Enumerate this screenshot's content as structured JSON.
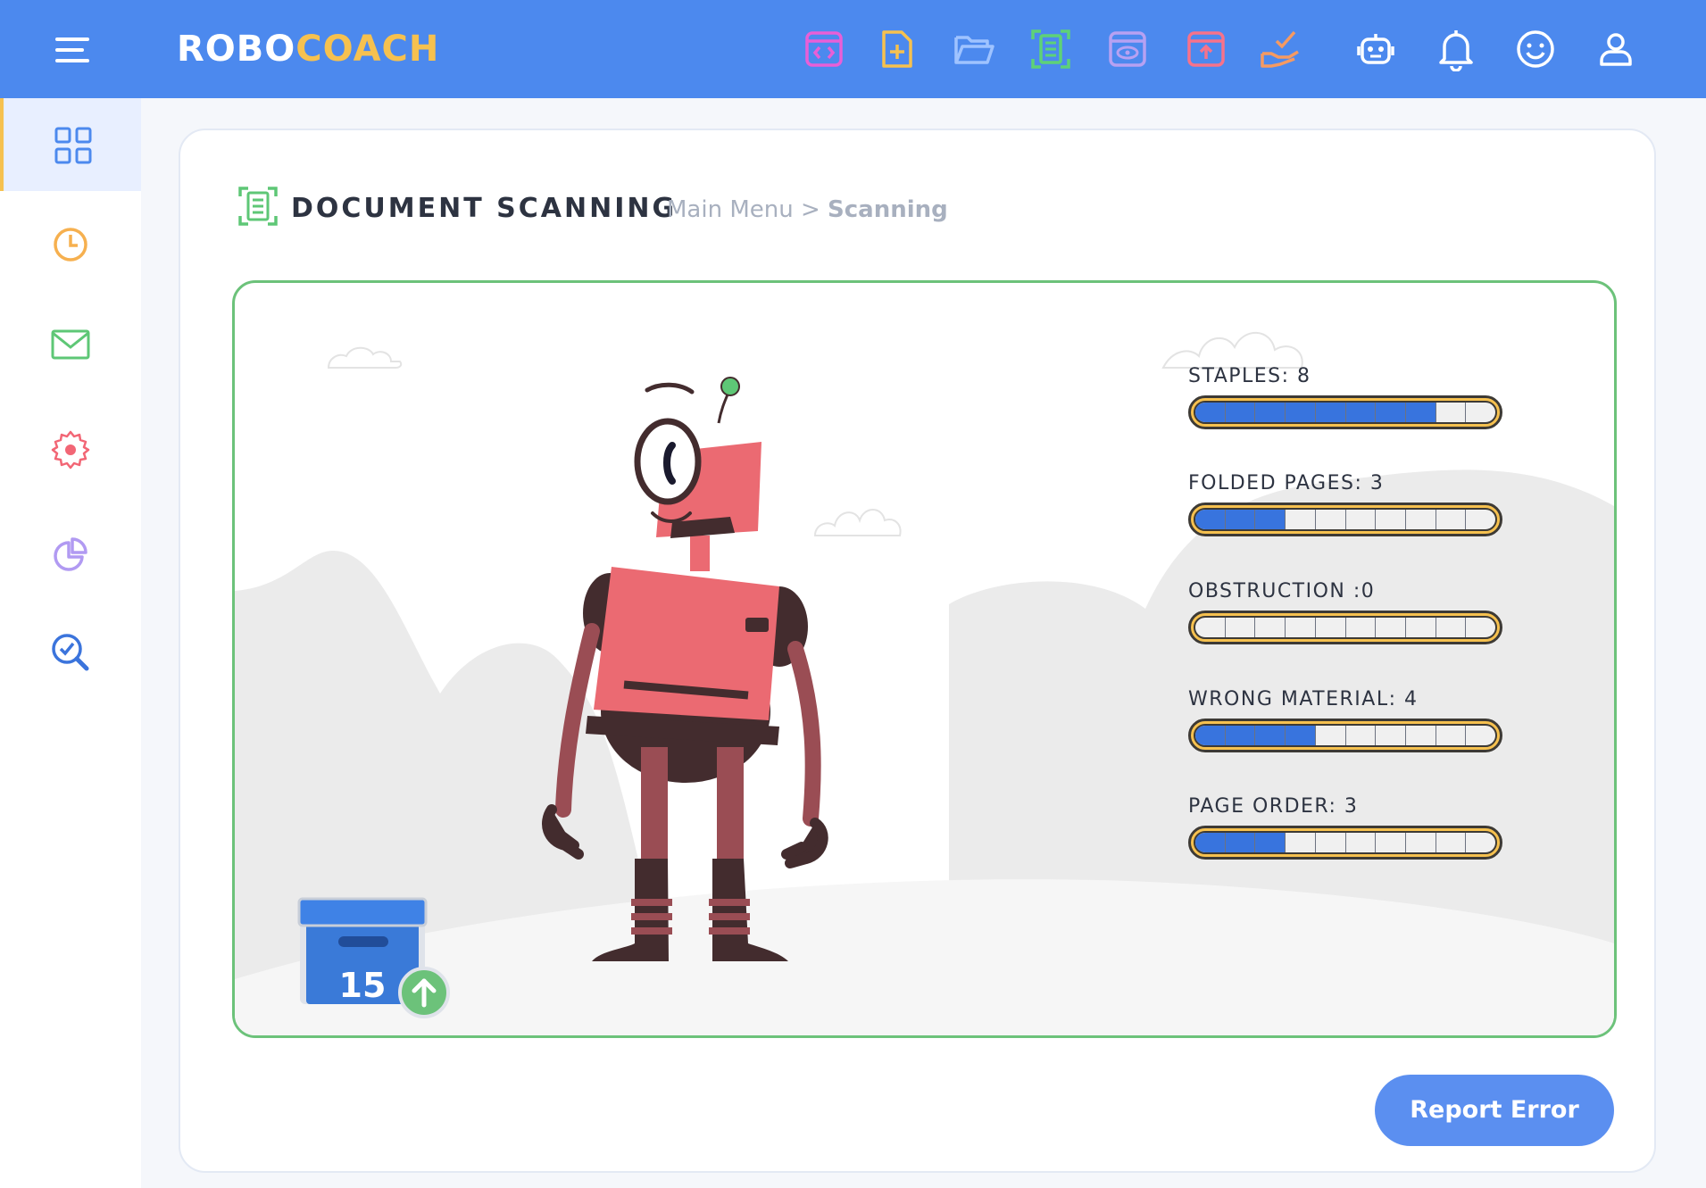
{
  "app": {
    "logo_part1": "ROBO",
    "logo_part2": "COACH"
  },
  "colors": {
    "topbar": "#4c89ee",
    "accent_yellow": "#f6c14f",
    "scene_border": "#6cc27a",
    "progress_fill": "#3874de",
    "robot_body": "#eb6a72",
    "robot_dark": "#432c2e",
    "report_button": "#5b8ff0"
  },
  "toolbar": {
    "icons": [
      "code-file-icon",
      "new-file-icon",
      "open-folder-icon",
      "document-scan-icon",
      "preview-icon",
      "upload-file-icon",
      "hand-check-icon",
      "robot-icon",
      "bell-icon",
      "smiley-icon",
      "user-icon"
    ]
  },
  "sidebar": {
    "items": [
      {
        "icon": "dashboard-grid-icon",
        "active": true
      },
      {
        "icon": "clock-icon",
        "active": false
      },
      {
        "icon": "mail-icon",
        "active": false
      },
      {
        "icon": "settings-gear-icon",
        "active": false
      },
      {
        "icon": "pie-chart-icon",
        "active": false
      },
      {
        "icon": "search-check-icon",
        "active": false
      }
    ]
  },
  "page": {
    "title": "DOCUMENT SCANNING",
    "breadcrumb_root": "Main Menu",
    "breadcrumb_sep": ">",
    "breadcrumb_current": "Scanning"
  },
  "metrics": [
    {
      "label": "STAPLES: 8",
      "value": 8,
      "max": 10
    },
    {
      "label": "FOLDED PAGES: 3",
      "value": 3,
      "max": 10
    },
    {
      "label": "OBSTRUCTION :0",
      "value": 0,
      "max": 10
    },
    {
      "label": "WRONG MATERIAL: 4",
      "value": 4,
      "max": 10
    },
    {
      "label": "PAGE ORDER: 3",
      "value": 3,
      "max": 10
    }
  ],
  "box": {
    "count": "15"
  },
  "actions": {
    "report_error": "Report Error"
  }
}
